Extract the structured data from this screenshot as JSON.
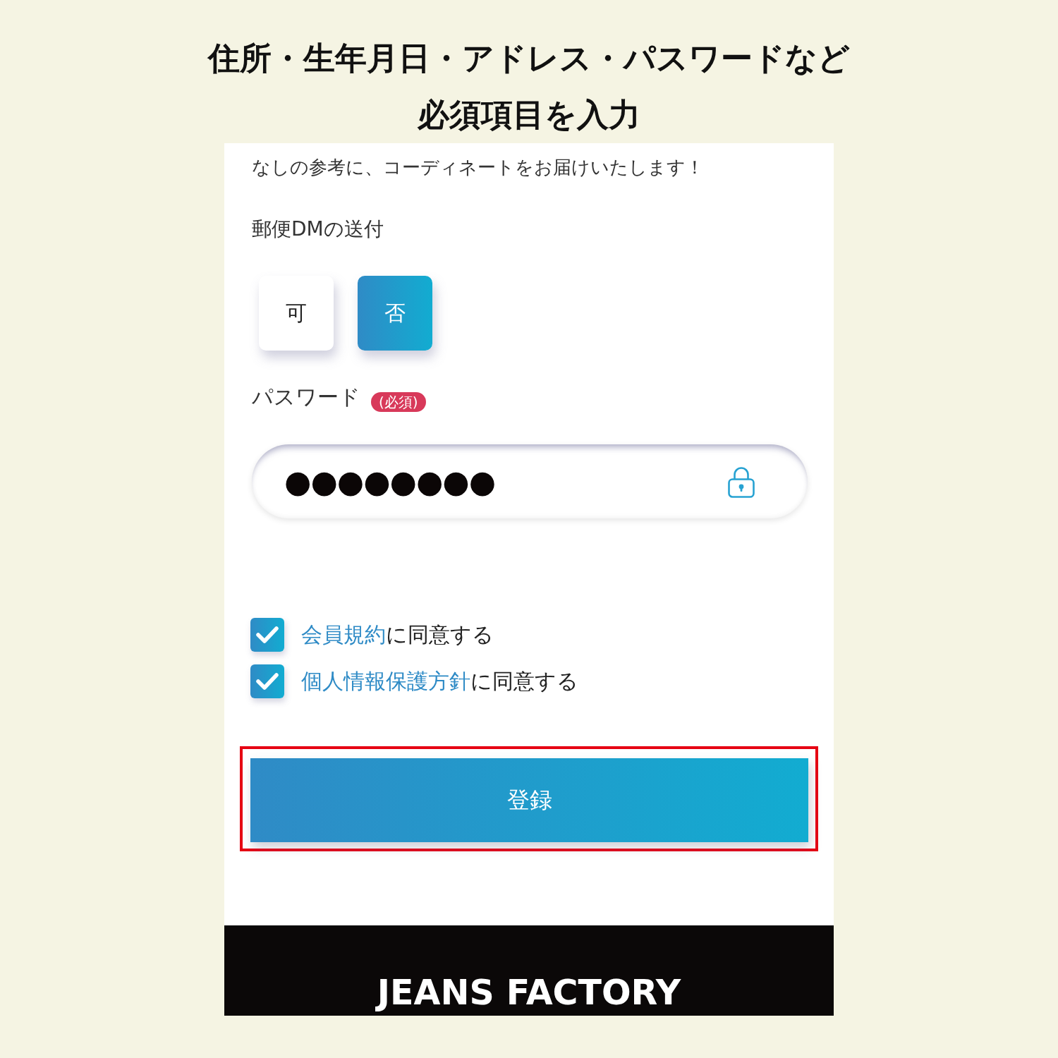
{
  "heading": {
    "lines": [
      "住所・生年月日・アドレス・パスワードなど",
      "必須項目を入力"
    ]
  },
  "form": {
    "intro": "なしの参考に、コーディネートをお届けいたします！",
    "dm": {
      "label": "郵便DMの送付",
      "options": [
        {
          "label": "可",
          "selected": false
        },
        {
          "label": "否",
          "selected": true
        }
      ]
    },
    "password": {
      "label": "パスワード",
      "badge": "(必須)",
      "value": "●●●●●●●●"
    },
    "agreements": [
      {
        "link": "会員規約",
        "text": "に同意する",
        "checked": true
      },
      {
        "link": "個人情報保護方針",
        "text": "に同意する",
        "checked": true
      }
    ],
    "submit": {
      "label": "登録",
      "highlighted": true
    }
  },
  "footer": {
    "logo": "JEANS FACTORY"
  }
}
